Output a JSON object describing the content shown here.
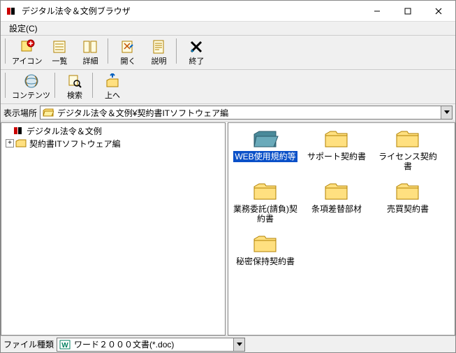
{
  "window": {
    "title": "デジタル法令＆文例ブラウザ"
  },
  "menu": {
    "settings": "設定(C)"
  },
  "toolbar1": {
    "icon": "アイコン",
    "list": "一覧",
    "detail": "詳細",
    "open": "開く",
    "desc": "説明",
    "exit": "終了"
  },
  "toolbar2": {
    "contents": "コンテンツ",
    "search": "検索",
    "up": "上へ"
  },
  "addressbar": {
    "label": "表示場所",
    "path": "デジタル法令＆文例¥契約書ITソフトウェア編"
  },
  "tree": {
    "root": "デジタル法令＆文例",
    "child1": "契約書ITソフトウェア編"
  },
  "folders": [
    {
      "label": "WEB使用規約等",
      "selected": true,
      "open": true
    },
    {
      "label": "サポート契約書",
      "selected": false,
      "open": false
    },
    {
      "label": "ライセンス契約書",
      "selected": false,
      "open": false
    },
    {
      "label": "業務委託(請負)契約書",
      "selected": false,
      "open": false
    },
    {
      "label": "条項差替部材",
      "selected": false,
      "open": false
    },
    {
      "label": "売買契約書",
      "selected": false,
      "open": false
    },
    {
      "label": "秘密保持契約書",
      "selected": false,
      "open": false
    }
  ],
  "statusbar": {
    "label": "ファイル種類",
    "value": "ワード２０００文書(*.doc)"
  }
}
